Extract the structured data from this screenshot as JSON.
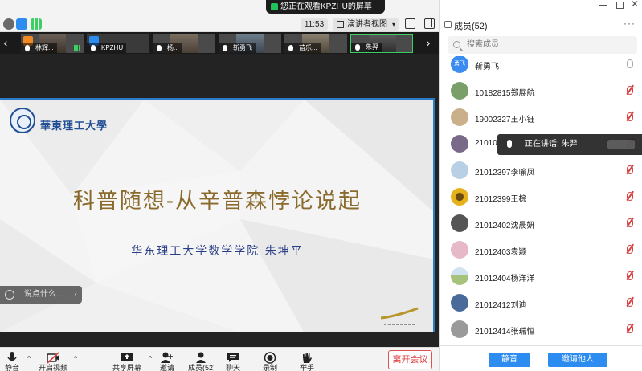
{
  "share_banner": "您正在观看KPZHU的屏幕",
  "time": "11:53",
  "view_mode": "演讲者视图",
  "thumbnails": [
    {
      "name": "林辉..."
    },
    {
      "name": "KPZHU"
    },
    {
      "name": "杨..."
    },
    {
      "name": "靳勇飞"
    },
    {
      "name": "苗乐..."
    },
    {
      "name": "朱羿"
    }
  ],
  "slide": {
    "university": "華東理工大學",
    "title": "科普随想-从辛普森悖论说起",
    "subtitle": "华东理工大学数学学院  朱坤平"
  },
  "chat": {
    "placeholder": "说点什么..."
  },
  "toolbar": {
    "items": [
      {
        "label": "静音"
      },
      {
        "label": "开启视频"
      },
      {
        "label": "共享屏幕"
      },
      {
        "label": "邀请"
      },
      {
        "label": "成员(52)"
      },
      {
        "label": "聊天"
      },
      {
        "label": "录制"
      },
      {
        "label": "举手"
      }
    ],
    "leave": "离开会议"
  },
  "panel": {
    "title": "成员(52)",
    "search_placeholder": "搜索成员",
    "speaking_toast": "正在讲话: 朱羿",
    "mute_all": "静音",
    "invite": "邀请他人"
  },
  "participants": [
    {
      "name": "靳勇飞",
      "avatar_color": "#3b8cf0",
      "avatar_text": "勇飞",
      "mic": "on"
    },
    {
      "name": "10182815郑展航",
      "avatar_color": "#7aa06a",
      "mic": "muted"
    },
    {
      "name": "19002327王小钰",
      "avatar_color": "#c9b08a",
      "mic": "muted"
    },
    {
      "name": "21010",
      "avatar_color": "#7a6a8a",
      "mic": "muted"
    },
    {
      "name": "21012397李喻凤",
      "avatar_color": "#b8d0e6",
      "mic": "muted"
    },
    {
      "name": "21012399王棕",
      "avatar_color": "#e5b21c",
      "mic": "muted"
    },
    {
      "name": "21012402沈晨妍",
      "avatar_color": "#555555",
      "mic": "muted"
    },
    {
      "name": "21012403袁颖",
      "avatar_color": "#e6b8c8",
      "mic": "muted"
    },
    {
      "name": "21012404杨洋洋",
      "avatar_color": "#a7c27a",
      "mic": "muted"
    },
    {
      "name": "21012412刘迪",
      "avatar_color": "#4a6a9a",
      "mic": "muted"
    },
    {
      "name": "21012414张瑞恒",
      "avatar_color": "#9a9a9a",
      "mic": "muted"
    }
  ]
}
